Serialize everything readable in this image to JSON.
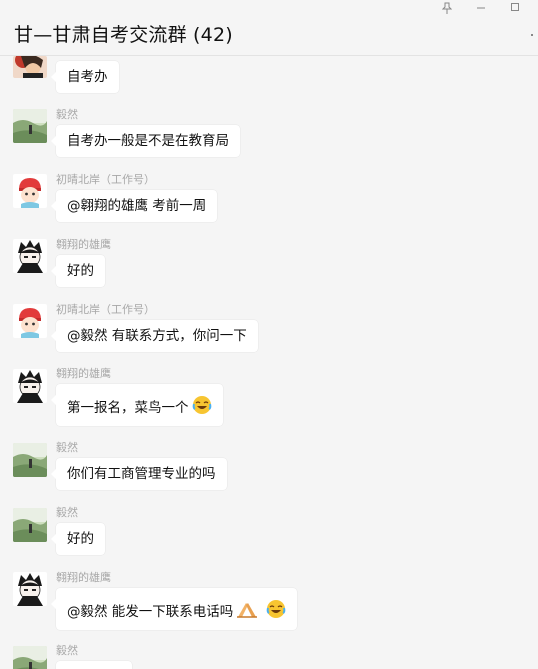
{
  "window": {
    "title": "甘—甘肃自考交流群 (42)",
    "pin_icon": "pin-icon",
    "minimize_icon": "minimize-icon",
    "maximize_icon": "maximize-icon",
    "more_icon": "more-icon"
  },
  "colors": {
    "background": "#f5f5f5",
    "bubble": "#ffffff",
    "name_text": "#a8a8a8",
    "text": "#111111"
  },
  "messages": [
    {
      "sender": "",
      "text": "自考办",
      "avatar": "red-flower-avatar"
    },
    {
      "sender": "毅然",
      "text": "自考办一般是不是在教育局",
      "avatar": "landscape-avatar"
    },
    {
      "sender": "初晴北岸（工作号）",
      "text": "@翱翔的雄鹰 考前一周",
      "avatar": "cartoon-girl-avatar"
    },
    {
      "sender": "翱翔的雄鹰",
      "text": "好的",
      "avatar": "anime-boy-avatar"
    },
    {
      "sender": "初晴北岸（工作号）",
      "text": "@毅然 有联系方式，你问一下",
      "avatar": "cartoon-girl-avatar"
    },
    {
      "sender": "翱翔的雄鹰",
      "text": "第一报名，菜鸟一个",
      "avatar": "anime-boy-avatar",
      "emojis": [
        "laughing-tears-emoji"
      ]
    },
    {
      "sender": "毅然",
      "text": "你们有工商管理专业的吗",
      "avatar": "landscape-avatar"
    },
    {
      "sender": "毅然",
      "text": "好的",
      "avatar": "landscape-avatar"
    },
    {
      "sender": "翱翔的雄鹰",
      "text": "@毅然 能发一下联系电话吗",
      "avatar": "anime-boy-avatar",
      "emojis": [
        "praying-hands-emoji",
        "laughing-tears-emoji"
      ]
    },
    {
      "sender": "毅然",
      "text": "",
      "avatar": "landscape-avatar"
    }
  ]
}
